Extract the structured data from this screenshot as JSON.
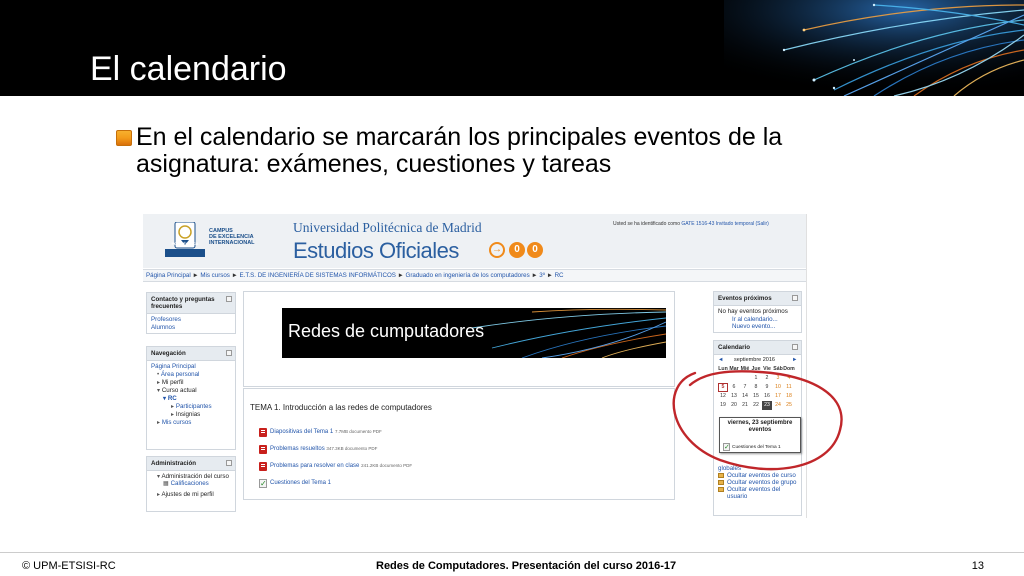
{
  "slide": {
    "title": "El calendario",
    "bullet": "En el calendario se marcarán los principales eventos de la asignatura: exámenes, cuestiones y tareas"
  },
  "screenshot": {
    "header": {
      "campus_line1": "CAMPUS",
      "campus_line2": "DE EXCELENCIA",
      "campus_line3": "INTERNACIONAL",
      "logo_text": "POLITÉCNICA",
      "university": "Universidad Politécnica de Madrid",
      "estudios": "Estudios Oficiales",
      "arrow": "→",
      "badge_1": "0",
      "badge_2": "0",
      "login_prefix": "Usted se ha identificado como",
      "login_user": "GATE 1516-43 Invitado temporal",
      "login_suffix": "(Salir)"
    },
    "breadcrumb": [
      "Página Principal",
      "Mis cursos",
      "E.T.S. DE INGENIERÍA DE SISTEMAS INFORMÁTICOS",
      "Graduado en ingeniería de los computadores",
      "3º",
      "RC"
    ],
    "breadcrumb_sep": "►",
    "contacto": {
      "title": "Contacto y preguntas frecuentes",
      "items": [
        "Profesores",
        "Alumnos"
      ]
    },
    "navegacion": {
      "title": "Navegación",
      "items": [
        "Página Principal",
        "Área personal",
        "Mi perfil",
        "Curso actual",
        "RC",
        "Participantes",
        "Insignias",
        "Mis cursos"
      ]
    },
    "administracion": {
      "title": "Administración",
      "items": [
        "Administración del curso",
        "Calificaciones",
        "Ajustes de mi perfil"
      ]
    },
    "banner_title": "Redes de cumputadores",
    "tema": {
      "title": "TEMA 1. Introducción a las redes de computadores",
      "resources": [
        {
          "label": "Diapositivas del Tema 1",
          "meta": "7.7MB documento PDF"
        },
        {
          "label": "Problemas resueltos",
          "meta": "347.3KB documento PDF"
        },
        {
          "label": "Problemas para resolver en clase",
          "meta": "241.2KB documento PDF"
        },
        {
          "label": "Cuestiones del Tema 1",
          "meta": ""
        }
      ]
    },
    "eventos": {
      "title": "Eventos próximos",
      "none": "No hay eventos próximos",
      "links": [
        "Ir al calendario...",
        "Nuevo evento..."
      ]
    },
    "calendario": {
      "title": "Calendario",
      "prev": "◄",
      "month": "septiembre 2016",
      "next": "►",
      "days": [
        "Lun",
        "Mar",
        "Mié",
        "Jue",
        "Vie",
        "Sáb",
        "Dom"
      ],
      "weeks": [
        [
          "",
          "",
          "",
          "1",
          "2",
          "3",
          "4"
        ],
        [
          "5",
          "6",
          "7",
          "8",
          "9",
          "10",
          "11"
        ],
        [
          "12",
          "13",
          "14",
          "15",
          "16",
          "17",
          "18"
        ],
        [
          "19",
          "20",
          "21",
          "22",
          "23",
          "24",
          "25"
        ]
      ],
      "tooltip_date": "viernes, 23 septiembre eventos",
      "tooltip_item": "Cuestiones del Tema 1",
      "ocultar_partial": "globales",
      "ocultar": [
        "Ocultar eventos de curso",
        "Ocultar eventos de grupo",
        "Ocultar eventos del usuario"
      ]
    }
  },
  "footer": {
    "left": "© UPM-ETSISI-RC",
    "center": "Redes de Computadores. Presentación del curso 2016-17",
    "page": "13"
  },
  "colors": {
    "accent_orange": "#f08a1a",
    "link_blue": "#2255aa",
    "annotation_red": "#c0262a"
  }
}
